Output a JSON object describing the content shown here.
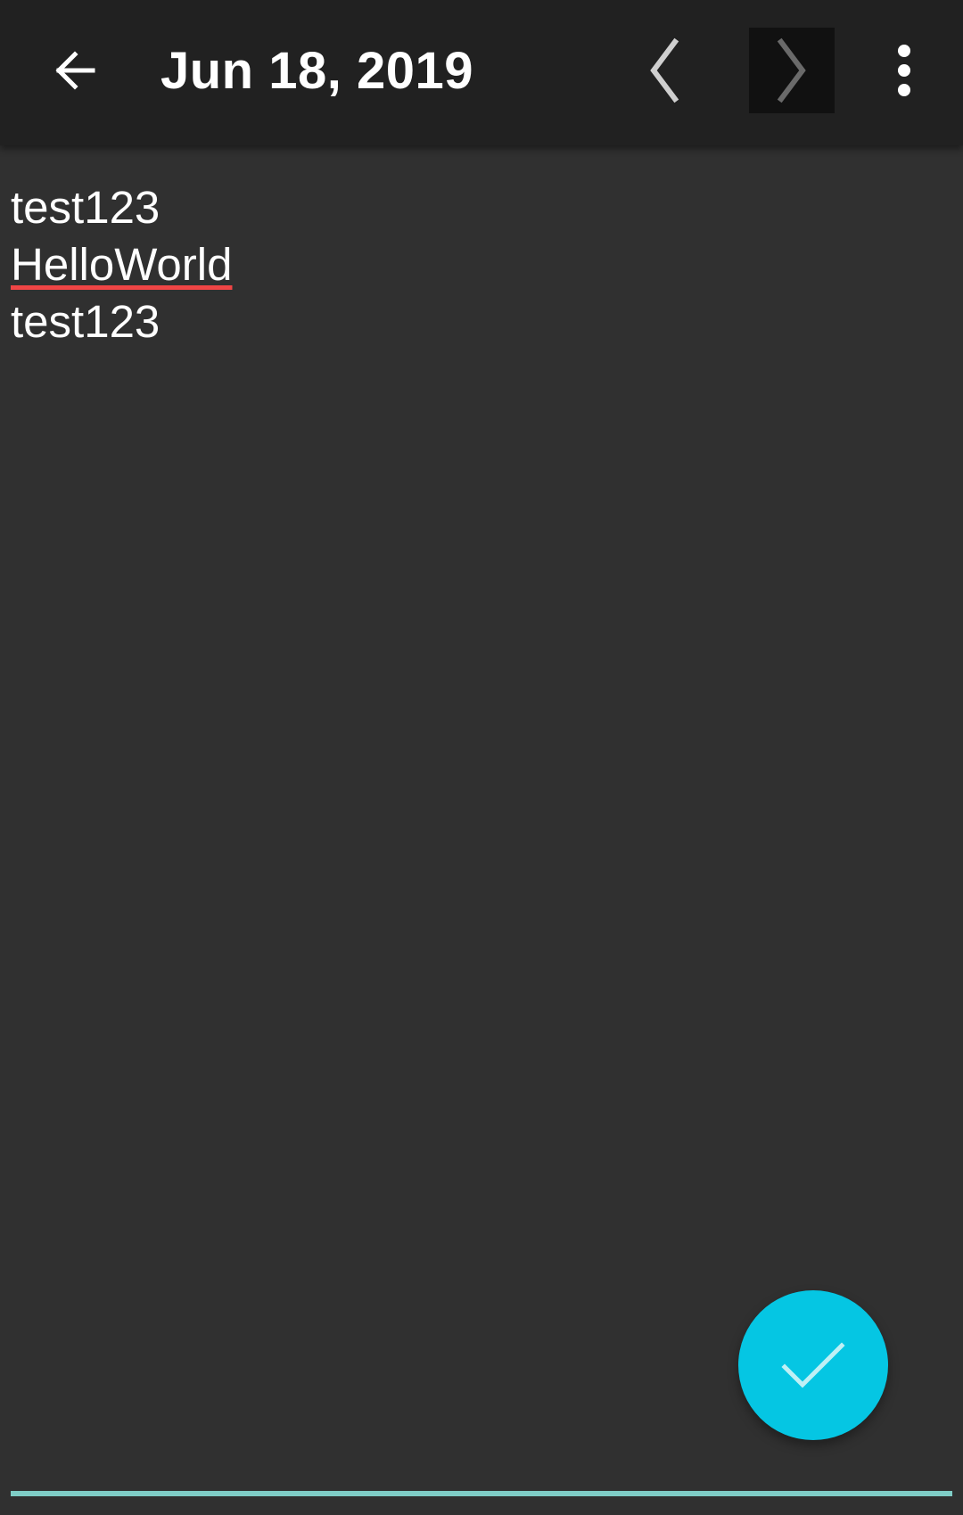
{
  "toolbar": {
    "title": "Jun 18, 2019",
    "back_icon": "arrow-left-icon",
    "prev_icon": "chevron-left-icon",
    "next_icon": "chevron-right-icon",
    "more_icon": "more-vert-icon"
  },
  "note": {
    "lines": [
      "test123",
      "HelloWorld",
      "test123"
    ],
    "misspelled_word": "HelloWorld"
  },
  "fab": {
    "icon": "check-icon"
  },
  "colors": {
    "toolbar_bg": "#212121",
    "content_bg": "#303030",
    "fab": "#05c6e3",
    "accent_line": "#7fcdc6",
    "spellcheck_underline": "#f04545",
    "next_button_bg": "#111111"
  }
}
